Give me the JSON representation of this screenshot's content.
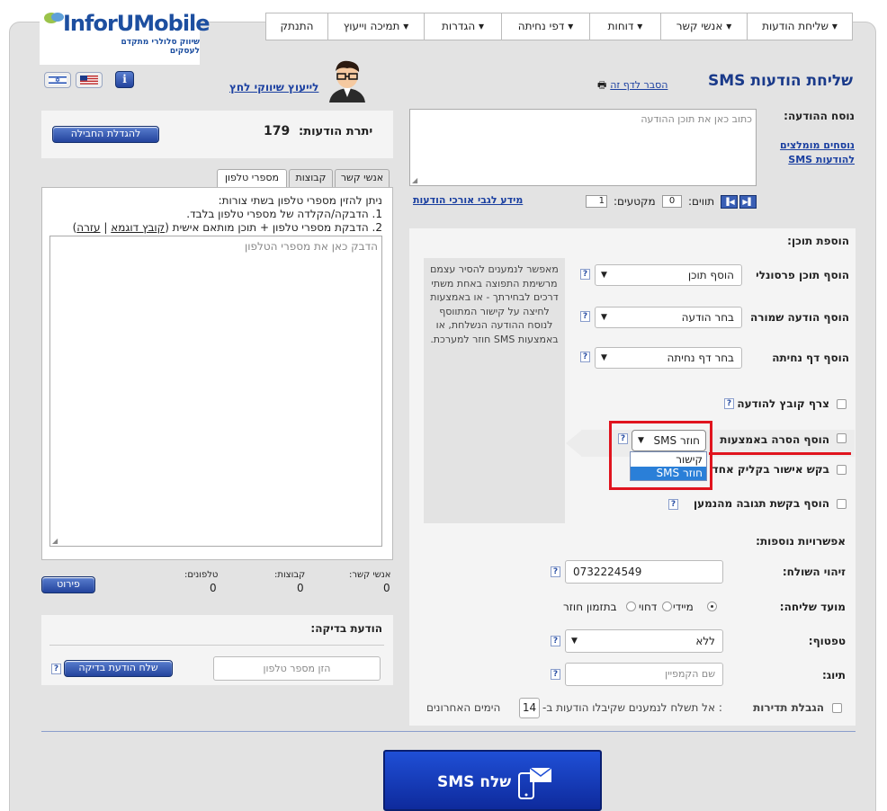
{
  "logo": {
    "brand": "InforUMobile",
    "tagline": "שיווק סלולרי מתקדם לעסקים"
  },
  "nav": {
    "send_messages": "שליחת הודעות",
    "contacts": "אנשי קשר",
    "reports": "דוחות",
    "landing_pages": "דפי נחיתה",
    "settings": "הגדרות",
    "support": "תמיכה וייעוץ",
    "logout": "התנתק"
  },
  "header": {
    "title": "שליחת הודעות SMS",
    "page_help_link": "הסבר לדף זה",
    "consult_link": "לייעוץ שיווקי לחץ"
  },
  "message": {
    "label": "נוסח ההודעה:",
    "placeholder": "כתוב כאן את תוכן ההודעה",
    "recommended_link_1": "נוסחים מומלצים",
    "recommended_link_2": "להודעות SMS",
    "chars_label": "תווים:",
    "chars_value": "0",
    "segments_label": "מקטעים:",
    "segments_value": "1",
    "long_info_link": "מידע לגבי אורכי הודעות"
  },
  "add_content": {
    "title": "הוספת תוכן:",
    "personal_label": "הוסף תוכן פרסונלי",
    "personal_select": "הוסף תוכן",
    "saved_label": "הוסף הודעה שמורה",
    "saved_select": "בחר הודעה",
    "landing_label": "הוסף דף נחיתה",
    "landing_select": "בחר דף נחיתה",
    "attach_label": "צרף קובץ להודעה",
    "removal_label": "הוסף הסרה באמצעות",
    "removal_select": "SMS חוזר",
    "removal_options": [
      "קישור",
      "SMS חוזר"
    ],
    "confirm_label": "בקש אישור בקליק אחד",
    "response_label": "הוסף בקשת תגובה מהנמען",
    "info_text": "מאפשר לנמענים להסיר עצמם מרשימת התפוצה באחת משתי דרכים לבחירתך - או באמצעות לחיצה על קישור המתווסף לנוסח ההודעה הנשלחת, או באמצעות SMS חוזר למערכת."
  },
  "options": {
    "title": "אפשרויות נוספות:",
    "sender_label": "זיהוי השולח:",
    "sender_value": "0732224549",
    "timing_label": "מועד שליחה:",
    "timing_now": "מיידי",
    "timing_delayed": "דחוי",
    "timing_return": "בתזמון חוזר",
    "throttle_label": "טפטוף:",
    "throttle_value": "ללא",
    "tag_label": "תיוג:",
    "tag_placeholder": "שם הקמפיין",
    "freq_bold": "הגבלת תדירות",
    "freq_text_1": ": אל תשלח לנמענים שקיבלו הודעות ב-",
    "freq_days": "14",
    "freq_text_2": "הימים האחרונים"
  },
  "balance": {
    "label": "יתרת הודעות:",
    "value": "179",
    "upgrade_button": "להגדלת החבילה"
  },
  "recipients": {
    "tabs": [
      "אנשי קשר",
      "קבוצות",
      "מספרי טלפון"
    ],
    "instructions": "ניתן להזין מספרי טלפון בשתי צורות:",
    "option_1": "1. הדבקה/הקלדה של מספרי טלפון בלבד.",
    "option_2": "2. הדבקת מספרי טלפון + תוכן מותאם אישית (",
    "sample_link": "קובץ דוגמא",
    "separator": "|",
    "help_link": "עזרה",
    "close_paren": ")",
    "phones_placeholder": "הדבק כאן את מספרי הטלפון",
    "count_contacts_label": "אנשי קשר:",
    "count_contacts": "0",
    "count_groups_label": "קבוצות:",
    "count_groups": "0",
    "count_phones_label": "טלפונים:",
    "count_phones": "0",
    "details_button": "פירוט"
  },
  "test": {
    "title": "הודעת בדיקה:",
    "phone_placeholder": "הזן מספר טלפון",
    "send_button": "שלח הודעת בדיקה"
  },
  "send": {
    "label": "שלח SMS"
  },
  "colors": {
    "accent": "#1a3fa0",
    "send_bg": "#1536b8",
    "highlight": "#e0141e"
  }
}
